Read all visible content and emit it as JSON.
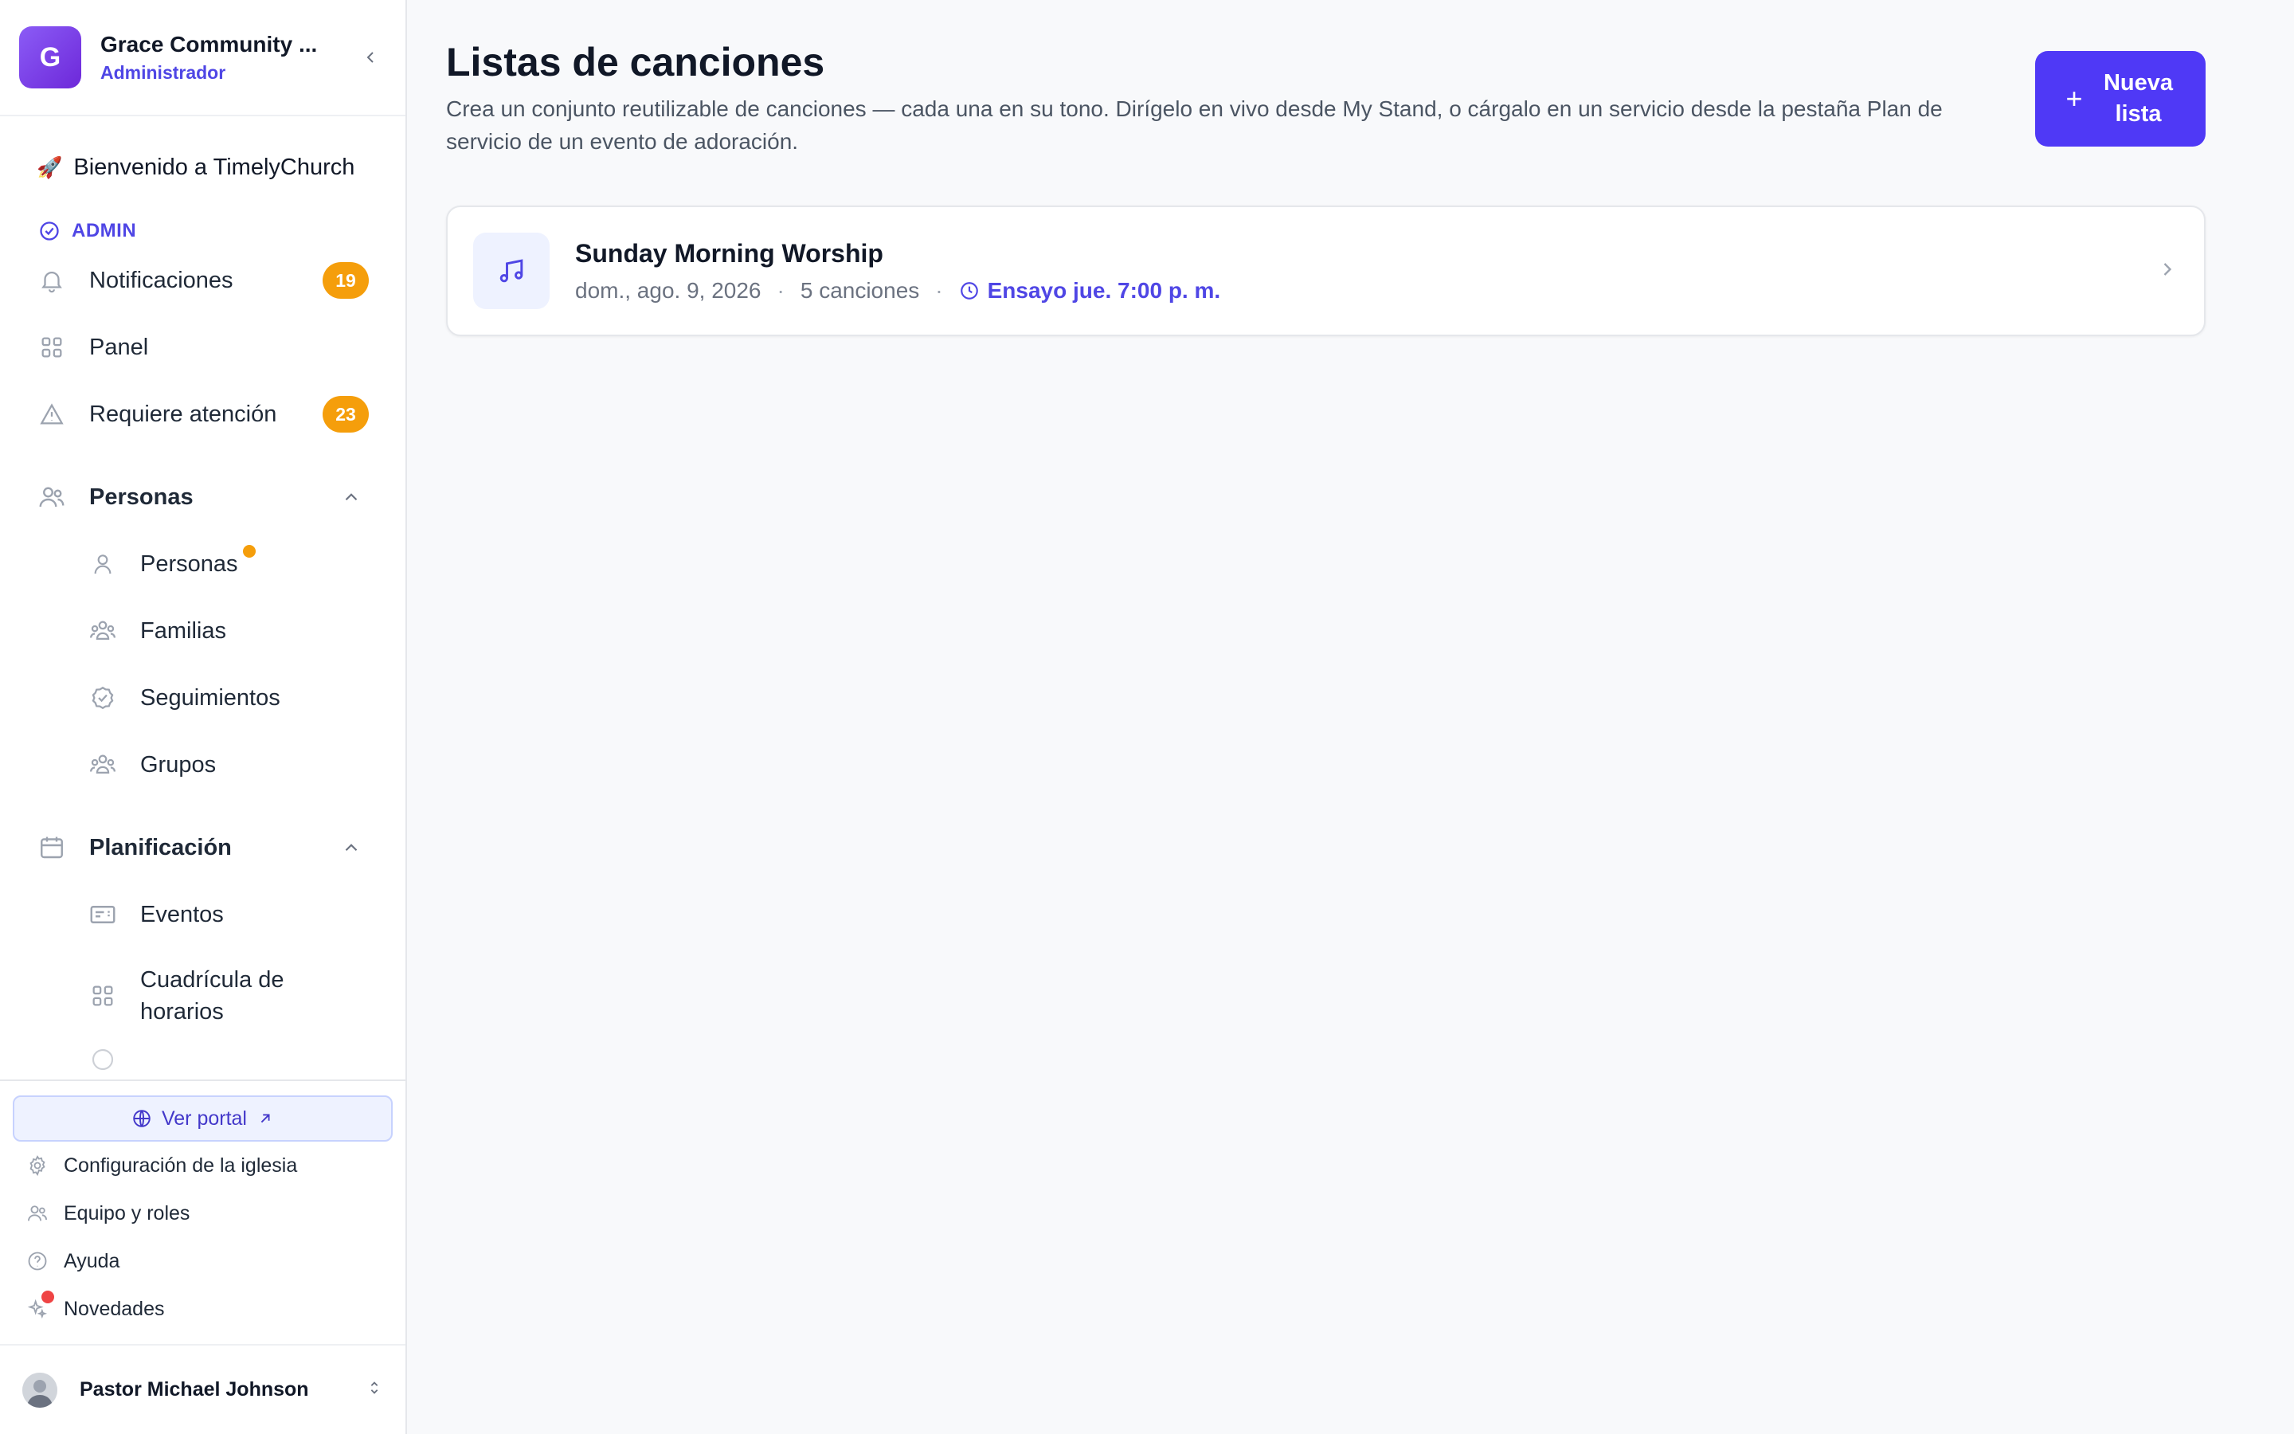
{
  "org": {
    "initial": "G",
    "name": "Grace Community ...",
    "role": "Administrador"
  },
  "nav": {
    "welcome": "Bienvenido a TimelyChurch",
    "section_admin": "ADMIN",
    "notifications": {
      "label": "Notificaciones",
      "count": "19"
    },
    "panel": "Panel",
    "attention": {
      "label": "Requiere atención",
      "count": "23"
    },
    "people_group": "Personas",
    "people_items": [
      "Personas",
      "Familias",
      "Seguimientos",
      "Grupos"
    ],
    "planning_group": "Planificación",
    "planning_items": [
      "Eventos",
      "Cuadrícula de horarios"
    ]
  },
  "footer": {
    "portal": "Ver portal",
    "links": [
      "Configuración de la iglesia",
      "Equipo y roles",
      "Ayuda",
      "Novedades"
    ],
    "user_name": "Pastor Michael Johnson"
  },
  "main": {
    "title": "Listas de canciones",
    "description": "Crea un conjunto reutilizable de canciones — cada una en su tono. Dirígelo en vivo desde My Stand, o cárgalo en un servicio desde la pestaña Plan de servicio de un evento de adoración.",
    "new_button": "Nueva lista",
    "lists": [
      {
        "title": "Sunday Morning Worship",
        "date": "dom., ago. 9, 2026",
        "songs": "5 canciones",
        "rehearsal": "Ensayo jue. 7:00 p. m."
      }
    ]
  },
  "colors": {
    "accent": "#4f39f6",
    "brand_text": "#4f46e5",
    "badge": "#f59e0b",
    "alert_dot": "#ef4444"
  }
}
